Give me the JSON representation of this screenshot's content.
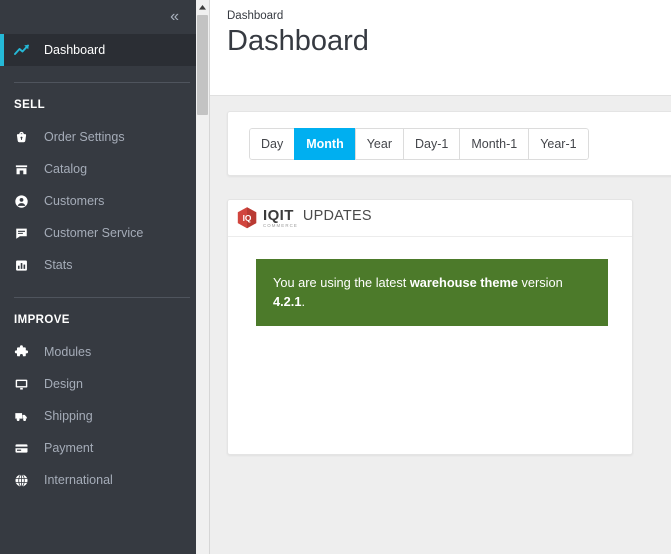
{
  "sidebar": {
    "collapse_icon": "chevron-double-left-icon",
    "items": [
      {
        "label": "Dashboard",
        "icon": "trend-up-icon",
        "active": true
      }
    ],
    "sections": [
      {
        "title": "SELL",
        "items": [
          {
            "label": "Order Settings",
            "icon": "basket-icon"
          },
          {
            "label": "Catalog",
            "icon": "storefront-icon"
          },
          {
            "label": "Customers",
            "icon": "user-circle-icon"
          },
          {
            "label": "Customer Service",
            "icon": "chat-bubble-icon"
          },
          {
            "label": "Stats",
            "icon": "bar-chart-icon"
          }
        ]
      },
      {
        "title": "IMPROVE",
        "items": [
          {
            "label": "Modules",
            "icon": "puzzle-piece-icon"
          },
          {
            "label": "Design",
            "icon": "monitor-icon"
          },
          {
            "label": "Shipping",
            "icon": "truck-icon"
          },
          {
            "label": "Payment",
            "icon": "credit-card-icon"
          },
          {
            "label": "International",
            "icon": "globe-icon"
          }
        ]
      }
    ]
  },
  "header": {
    "breadcrumb": "Dashboard",
    "title": "Dashboard"
  },
  "date_range_tabs": [
    {
      "label": "Day",
      "active": false
    },
    {
      "label": "Month",
      "active": true
    },
    {
      "label": "Year",
      "active": false
    },
    {
      "label": "Day-1",
      "active": false
    },
    {
      "label": "Month-1",
      "active": false
    },
    {
      "label": "Year-1",
      "active": false
    }
  ],
  "iqit_panel": {
    "logo_mark": "iqit-hexagon-logo-icon",
    "brand": "IQIT",
    "brand_sub": "COMMERCE",
    "updates_word": "UPDATES",
    "alert": {
      "text_before": "You are using the latest ",
      "highlight": "warehouse theme",
      "text_after": " version ",
      "version": "4.2.1",
      "text_end": ".",
      "color": "#4c7a2a"
    }
  },
  "colors": {
    "sidebar_bg": "#363a41",
    "sidebar_active_bg": "#2b2e34",
    "accent_cyan": "#25b9d7",
    "tab_active_blue": "#00aff0",
    "alert_green": "#4c7a2a",
    "page_bg": "#eeeeee"
  },
  "scrollbar": {
    "up_arrow_icon": "chevron-up-icon"
  }
}
